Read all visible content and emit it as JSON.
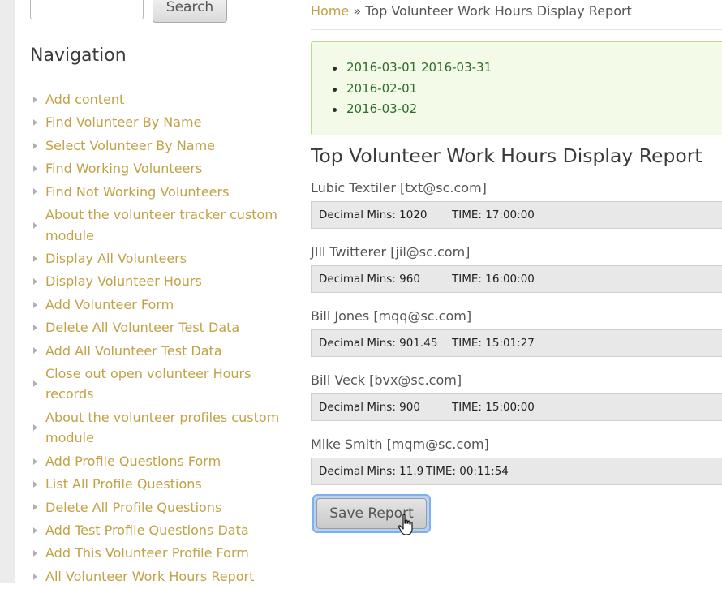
{
  "search": {
    "button_label": "Search"
  },
  "sidebar": {
    "title": "Navigation",
    "items": [
      {
        "label": "Add content"
      },
      {
        "label": "Find Volunteer By Name"
      },
      {
        "label": "Select Volunteer By Name"
      },
      {
        "label": "Find Working Volunteers"
      },
      {
        "label": "Find Not Working Volunteers"
      },
      {
        "label": "About the volunteer tracker custom module"
      },
      {
        "label": "Display All Volunteers"
      },
      {
        "label": "Display Volunteer Hours"
      },
      {
        "label": "Add Volunteer Form"
      },
      {
        "label": "Delete All Volunteer Test Data"
      },
      {
        "label": "Add All Volunteer Test Data"
      },
      {
        "label": "Close out open volunteer Hours records"
      },
      {
        "label": "About the volunteer profiles custom module"
      },
      {
        "label": "Add Profile Questions Form"
      },
      {
        "label": "List All Profile Questions"
      },
      {
        "label": "Delete All Profile Questions"
      },
      {
        "label": "Add Test Profile Questions Data"
      },
      {
        "label": "Add This Volunteer Profile Form"
      },
      {
        "label": "All Volunteer Work Hours Report"
      }
    ]
  },
  "breadcrumb": {
    "home": "Home",
    "separator": "»",
    "current": "Top Volunteer Work Hours Display Report"
  },
  "messages": [
    "2016-03-01 2016-03-31",
    "2016-02-01",
    "2016-03-02"
  ],
  "report": {
    "title": "Top Volunteer Work Hours Display Report",
    "volunteers": [
      {
        "name": "Lubic Textiler [txt@sc.com]",
        "mins": "Decimal Mins: 1020",
        "time": "TIME: 17:00:00"
      },
      {
        "name": "JIll Twitterer [jil@sc.com]",
        "mins": "Decimal Mins: 960",
        "time": "TIME: 16:00:00"
      },
      {
        "name": "Bill Jones [mqq@sc.com]",
        "mins": "Decimal Mins: 901.45",
        "time": "TIME: 15:01:27"
      },
      {
        "name": "Bill Veck [bvx@sc.com]",
        "mins": "Decimal Mins: 900",
        "time": "TIME: 15:00:00"
      },
      {
        "name": "Mike Smith [mqm@sc.com]",
        "mins": "Decimal Mins: 11.9",
        "time": "TIME: 00:11:54"
      }
    ],
    "save_label": "Save Report"
  },
  "colors": {
    "link": "#c1a247",
    "status_bg": "#f3fbe8",
    "status_border": "#b9dd8a",
    "status_text": "#2f6b2a",
    "focus_ring": "#7fb0ee"
  },
  "icons": {
    "nav_bullet": "triangle-right-icon",
    "cursor": "hand-pointer-icon"
  }
}
